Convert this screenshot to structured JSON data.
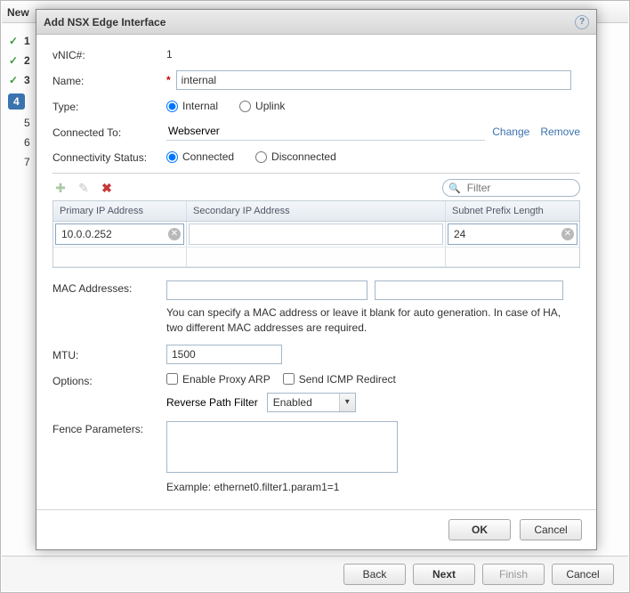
{
  "wizard": {
    "title_fragment": "New",
    "steps": [
      {
        "num": "1",
        "done": true
      },
      {
        "num": "2",
        "done": true
      },
      {
        "num": "3",
        "done": true
      },
      {
        "num": "4",
        "active": true
      },
      {
        "num": "5"
      },
      {
        "num": "6"
      },
      {
        "num": "7"
      }
    ],
    "buttons": {
      "back": "Back",
      "next": "Next",
      "finish": "Finish",
      "cancel": "Cancel"
    }
  },
  "dialog": {
    "title": "Add NSX Edge Interface",
    "labels": {
      "vnic": "vNIC#:",
      "name": "Name:",
      "type": "Type:",
      "connected_to": "Connected To:",
      "connectivity_status": "Connectivity Status:",
      "mac": "MAC Addresses:",
      "mtu": "MTU:",
      "options": "Options:",
      "fence": "Fence Parameters:"
    },
    "values": {
      "vnic": "1",
      "name": "internal",
      "connected_to": "Webserver",
      "mtu": "1500",
      "mac1": "",
      "mac2": "",
      "fence": ""
    },
    "type_options": {
      "internal": "Internal",
      "uplink": "Uplink"
    },
    "connectivity_options": {
      "connected": "Connected",
      "disconnected": "Disconnected"
    },
    "links": {
      "change": "Change",
      "remove": "Remove"
    },
    "filter_placeholder": "Filter",
    "grid": {
      "headers": {
        "primary": "Primary IP Address",
        "secondary": "Secondary IP Address",
        "prefix": "Subnet Prefix Length"
      },
      "row": {
        "primary": "10.0.0.252",
        "secondary": "",
        "prefix": "24"
      }
    },
    "mac_hint": "You can specify a MAC address or leave it blank for auto generation. In case of HA, two different MAC addresses are required.",
    "options": {
      "proxy_arp": "Enable Proxy ARP",
      "icmp": "Send ICMP Redirect",
      "rpf_label": "Reverse Path Filter",
      "rpf_value": "Enabled"
    },
    "example": "Example: ethernet0.filter1.param1=1",
    "buttons": {
      "ok": "OK",
      "cancel": "Cancel"
    }
  }
}
